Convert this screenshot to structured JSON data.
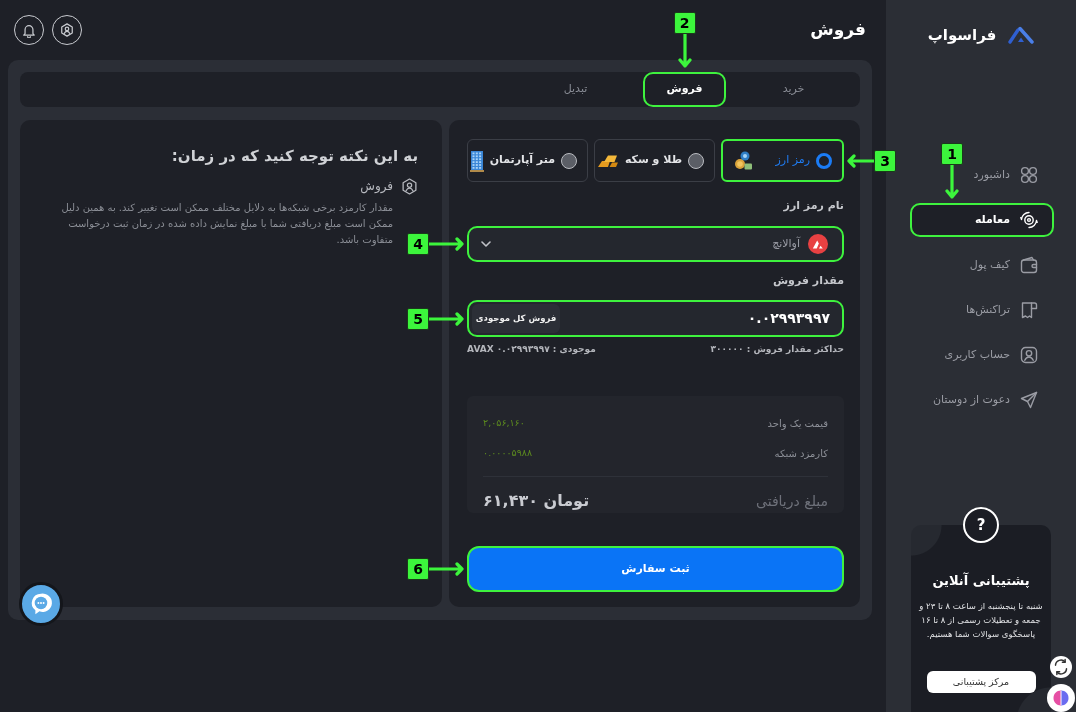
{
  "sidebar": {
    "logo": "فراسواپ",
    "items": [
      {
        "label": "داشبورد",
        "selected": false
      },
      {
        "label": "معامله",
        "selected": true,
        "callout": {
          "number": "1",
          "kind": "down"
        }
      },
      {
        "label": "کیف پول",
        "selected": false
      },
      {
        "label": "تراکنش‌ها",
        "selected": false
      },
      {
        "label": "حساب کاربری",
        "selected": false
      },
      {
        "label": "دعوت از دوستان",
        "selected": false
      }
    ],
    "support": {
      "mark": "?",
      "title": "پشتیبانی آنلاین",
      "text": "شنبه تا پنجشنبه از ساعت ۸ تا ۲۳ و جمعه و تعطیلات رسمی از ۸ تا ۱۶ پاسخگوی سوالات شما هستیم.",
      "button": "مرکز پشتیبانی"
    }
  },
  "header": {
    "title": "فروش"
  },
  "tabs": [
    {
      "label": "خرید",
      "selected": false
    },
    {
      "label": "فروش",
      "selected": true,
      "callout": {
        "number": "2",
        "kind": "down"
      }
    },
    {
      "label": "تبدیل",
      "selected": false
    }
  ],
  "order_form": {
    "asset_types": [
      {
        "label": "رمز ارز",
        "selected": true,
        "callout": {
          "number": "3",
          "kind": "left"
        }
      },
      {
        "label": "طلا و سکه",
        "selected": false
      },
      {
        "label": "متر آپارتمان",
        "selected": false
      }
    ],
    "currency": {
      "label": "نام رمز ارز",
      "value": "آوالانچ",
      "callout": {
        "number": "4",
        "kind": "right"
      }
    },
    "amount": {
      "label": "مقدار فروش",
      "value": "۰.۰۲۹۹۳۹۹۷",
      "button": "فروش کل موجودی",
      "callout": {
        "number": "5",
        "kind": "right"
      }
    },
    "max_hint": "حداکثر مقدار فروش : ۳۰۰۰۰۰",
    "balance_hint": "موجودی : ۰.۰۲۹۹۳۹۹۷ AVAX",
    "summary": {
      "rows": [
        {
          "label": "قیمت یک واحد",
          "value": "۲,۰۵۶,۱۶۰"
        },
        {
          "label": "کارمزد شبکه",
          "value": "۰.۰۰۰۰۵۹۸۸"
        }
      ],
      "total": {
        "label": "مبلغ دریافتی",
        "value": "۶۱,۴۳۰ تومان"
      }
    },
    "submit": {
      "label": "ثبت سفارش",
      "callout": {
        "number": "6",
        "kind": "right"
      }
    }
  },
  "notice": {
    "title": "به این نکته توجه کنید که در زمان:",
    "subtitle": "فروش",
    "text": "مقدار کارمزد برخی شبکه‌ها به دلایل مختلف ممکن است تغییر کند. به همین دلیل ممکن است مبلغ دریافتی شما با مبلغ نمایش داده شده در زمان ثبت درخواست متفاوت باشد."
  }
}
